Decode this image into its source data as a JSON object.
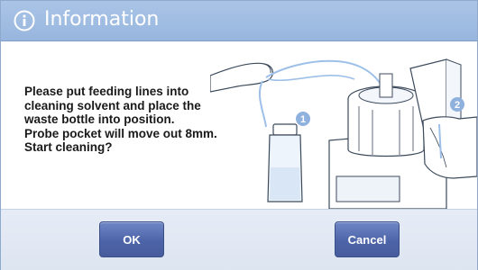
{
  "dialog": {
    "title": "Information",
    "icon": "info-icon",
    "message": "Please put feeding lines into\ncleaning solvent and place the\nwaste bottle into position.\nProbe pocket will move out 8mm.\nStart cleaning?",
    "illustration": {
      "step_markers": [
        "1",
        "2"
      ]
    },
    "buttons": {
      "ok_label": "OK",
      "cancel_label": "Cancel"
    }
  },
  "colors": {
    "titlebar": "#a2bee3",
    "button": "#5068ac",
    "footer": "#e2e9f4",
    "marker": "#8fb1de"
  }
}
